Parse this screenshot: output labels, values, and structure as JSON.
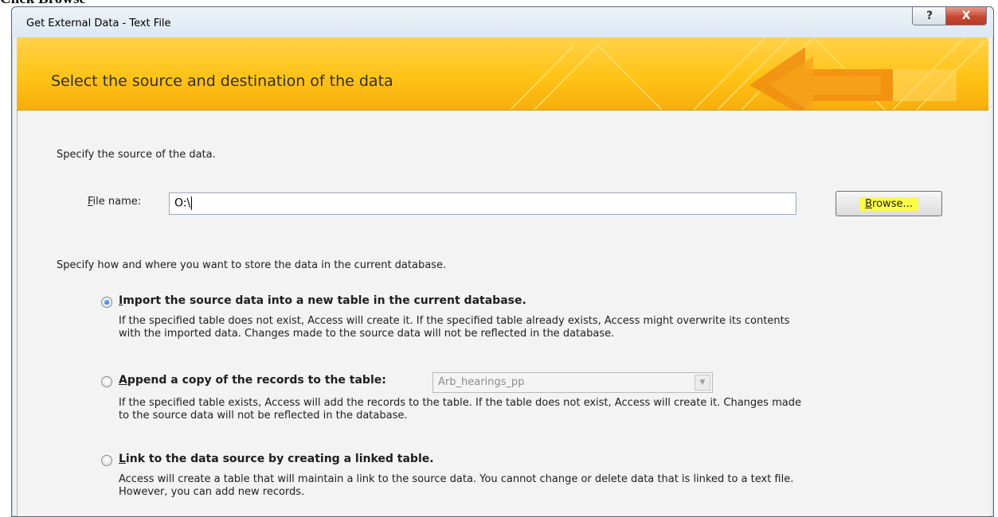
{
  "caption": "Click Browse",
  "window": {
    "title": "Get External Data - Text File",
    "help_glyph": "?",
    "close_glyph": "X"
  },
  "banner": {
    "title": "Select the source and destination of the data"
  },
  "source": {
    "prompt": "Specify the source of the data.",
    "file_label_hotkey": "F",
    "file_label_rest": "ile name:",
    "file_value": "O:\\",
    "browse_hotkey": "B",
    "browse_rest": "rowse..."
  },
  "storage": {
    "prompt": "Specify how and where you want to store the data in the current database.",
    "options": [
      {
        "hotkey": "I",
        "label_rest": "mport the source data into a new table in the current database.",
        "checked": true,
        "desc_lines": [
          "If the specified table does not exist, Access will create it. If the specified table already exists, Access might overwrite its contents",
          "with the imported data. Changes made to the source data will not be reflected in the database."
        ]
      },
      {
        "hotkey": "A",
        "label_rest": "ppend a copy of the records to the table:",
        "checked": false,
        "combo_value": "Arb_hearings_pp",
        "desc_lines": [
          "If the specified table exists, Access will add the records to the table. If the table does not exist, Access will create it. Changes made",
          "to the source data will not be reflected in the database."
        ]
      },
      {
        "hotkey": "L",
        "label_rest": "ink to the data source by creating a linked table.",
        "checked": false,
        "desc_lines": [
          "Access will create a table that will maintain a link to the source data. You cannot change or delete data that is linked to a text file.",
          "However, you can add new records."
        ]
      }
    ]
  },
  "colors": {
    "banner": "#ffc316",
    "browse_highlight": "#fbfb48",
    "close": "#c64832"
  }
}
